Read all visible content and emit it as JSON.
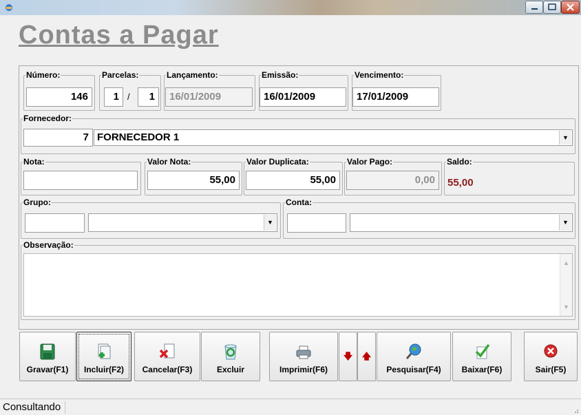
{
  "window": {
    "title": ""
  },
  "page_title": "Contas a Pagar",
  "fields": {
    "numero": {
      "label": "Número:",
      "value": "146"
    },
    "parcelas": {
      "label": "Parcelas:",
      "current": "1",
      "separator": "/",
      "total": "1"
    },
    "lancamento": {
      "label": "Lançamento:",
      "value": "16/01/2009"
    },
    "emissao": {
      "label": "Emissão:",
      "value": "16/01/2009"
    },
    "vencimento": {
      "label": "Vencimento:",
      "value": "17/01/2009"
    },
    "fornecedor": {
      "label": "Fornecedor:",
      "code": "7",
      "name": "FORNECEDOR 1"
    },
    "nota": {
      "label": "Nota:",
      "value": ""
    },
    "valor_nota": {
      "label": "Valor Nota:",
      "value": "55,00"
    },
    "valor_duplicata": {
      "label": "Valor Duplicata:",
      "value": "55,00"
    },
    "valor_pago": {
      "label": "Valor Pago:",
      "value": "0,00"
    },
    "saldo": {
      "label": "Saldo:",
      "value": "55,00",
      "color": "#8a1d1d"
    },
    "grupo": {
      "label": "Grupo:",
      "code": "",
      "name": ""
    },
    "conta": {
      "label": "Conta:",
      "code": "",
      "name": ""
    },
    "observacao": {
      "label": "Observação:",
      "value": ""
    }
  },
  "toolbar": {
    "gravar": {
      "label": "Gravar(F1)",
      "icon": "floppy-disk-icon"
    },
    "incluir": {
      "label": "Incluir(F2)",
      "icon": "new-document-icon"
    },
    "cancelar": {
      "label": "Cancelar(F3)",
      "icon": "cancel-document-icon"
    },
    "excluir": {
      "label": "Excluir",
      "icon": "recycle-bin-icon"
    },
    "imprimir": {
      "label": "Imprimir(F6)",
      "icon": "printer-icon"
    },
    "down": {
      "label": "🡇",
      "icon": "arrow-down-icon"
    },
    "up": {
      "label": "🡅",
      "icon": "arrow-up-icon"
    },
    "pesquisar": {
      "label": "Pesquisar(F4)",
      "icon": "search-globe-icon"
    },
    "baixar": {
      "label": "Baixar(F6)",
      "icon": "check-document-icon"
    },
    "sair": {
      "label": "Sair(F5)",
      "icon": "exit-icon"
    }
  },
  "status": {
    "text": "Consultando"
  },
  "colors": {
    "accent_red": "#c00000",
    "title_gray": "#8c8c8c"
  }
}
